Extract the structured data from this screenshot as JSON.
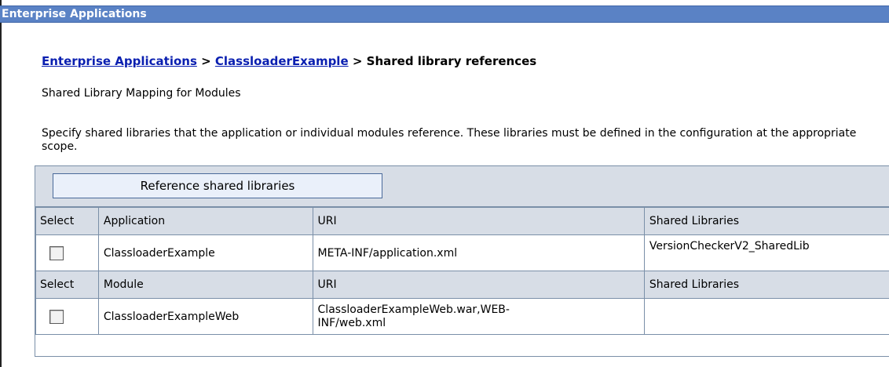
{
  "titlebar": {
    "title": "Enterprise Applications"
  },
  "breadcrumb": {
    "link1": "Enterprise Applications",
    "sep1": " > ",
    "link2": "ClassloaderExample",
    "sep2": " > ",
    "current": "Shared library references"
  },
  "subtitle": "Shared Library Mapping for Modules",
  "description": "Specify shared libraries that the application or individual modules reference. These libraries must be defined in the configuration at the appropriate scope.",
  "toolbar": {
    "reference_button": "Reference shared libraries"
  },
  "app_section": {
    "headers": [
      "Select",
      "Application",
      "URI",
      "Shared Libraries"
    ],
    "row": {
      "name": "ClassloaderExample",
      "uri": "META-INF/application.xml",
      "shared_libraries": "VersionCheckerV2_SharedLib"
    }
  },
  "module_section": {
    "headers": [
      "Select",
      "Module",
      "URI",
      "Shared Libraries"
    ],
    "row": {
      "name": "ClassloaderExampleWeb",
      "uri_line1": "ClassloaderExampleWeb.war,WEB-",
      "uri_line2": "INF/web.xml",
      "shared_libraries": ""
    }
  },
  "colors": {
    "titlebar": "#5a82c5",
    "link": "#0a1fb0",
    "table_header": "#d7dde6",
    "button_bg": "#eaf0fa"
  }
}
